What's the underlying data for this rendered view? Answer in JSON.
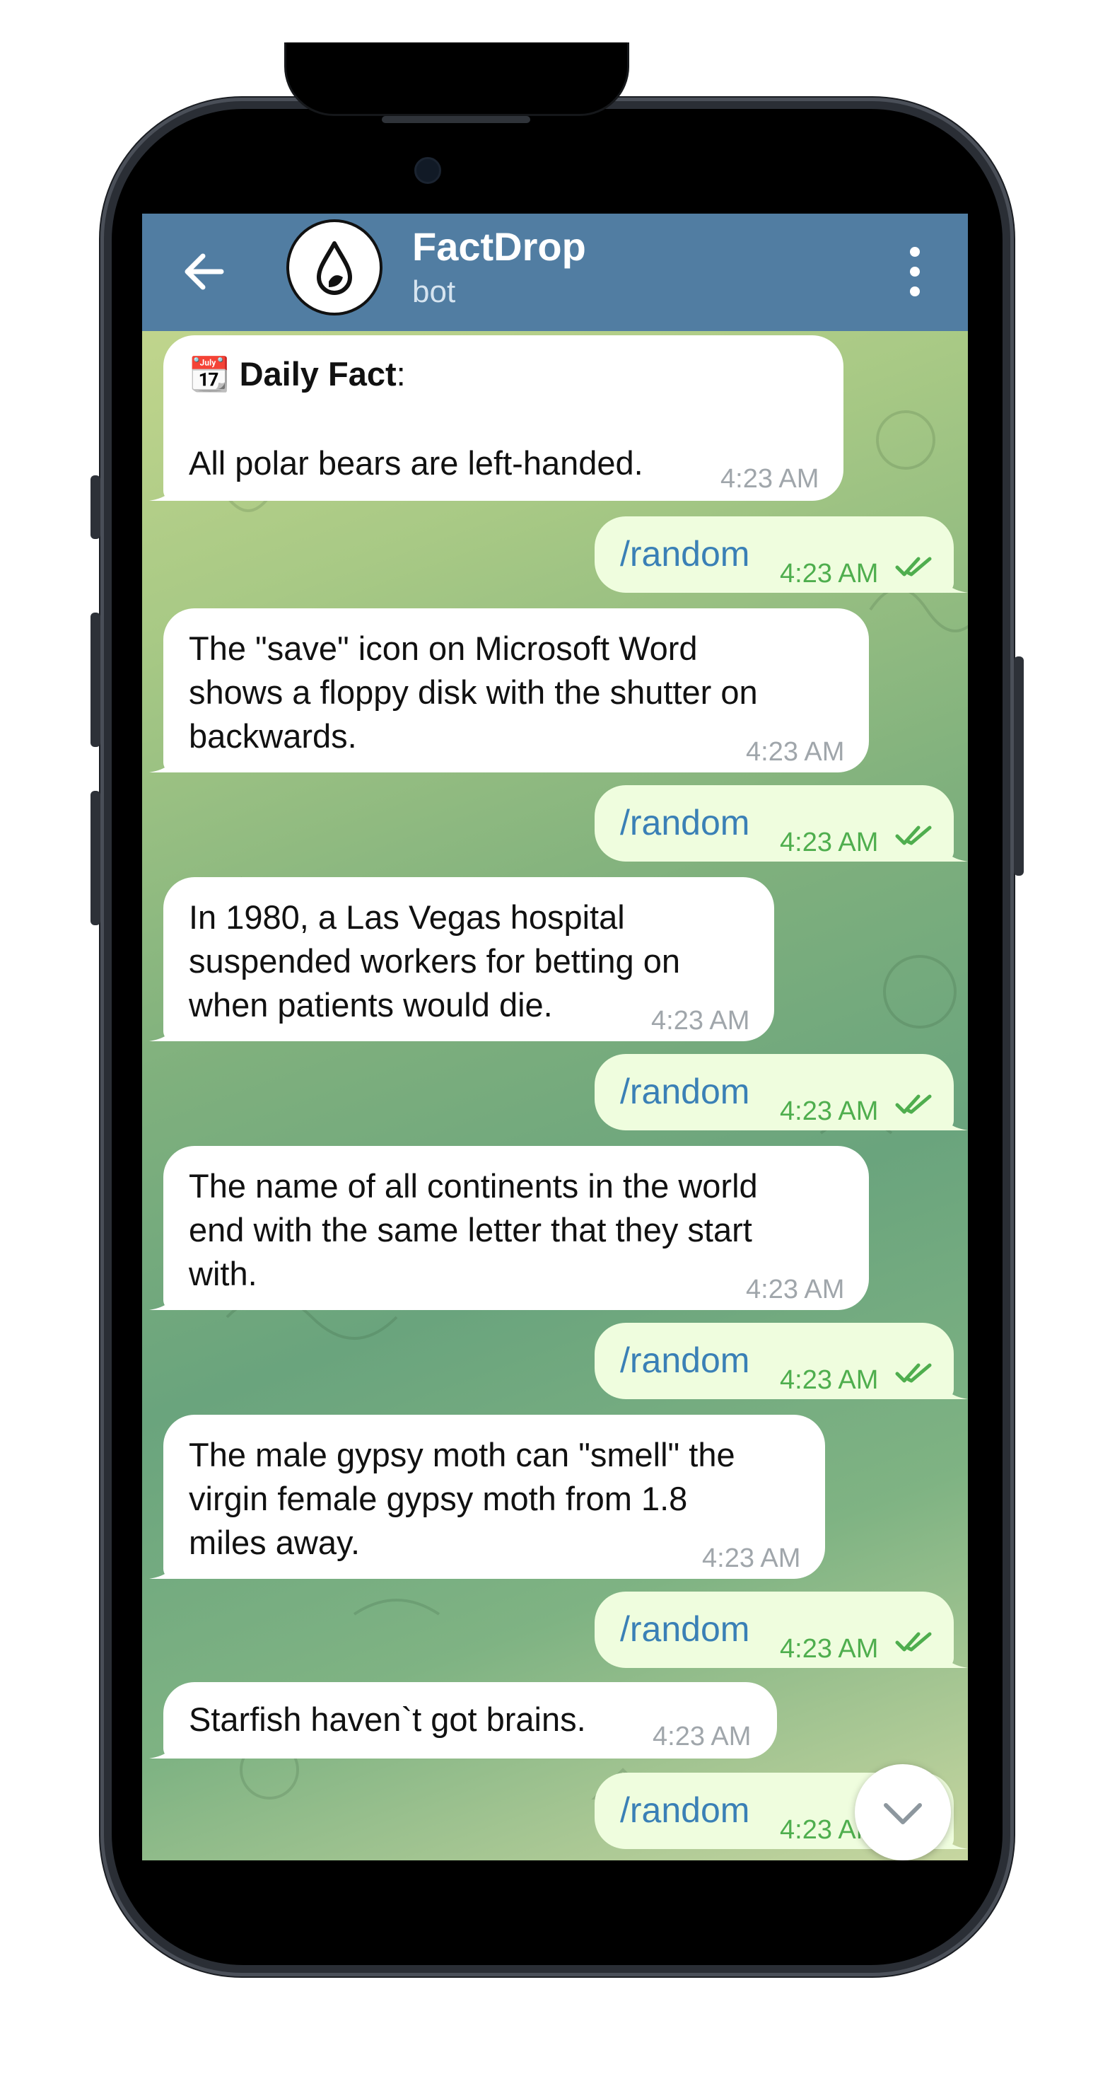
{
  "header": {
    "title": "FactDrop",
    "subtitle": "bot"
  },
  "messages": [
    {
      "type": "incoming",
      "lines": [
        "📆 Daily Fact:",
        "",
        "All polar bears are left-handed."
      ],
      "bold_prefix": "Daily Fact",
      "time": "4:23 AM"
    },
    {
      "type": "outgoing",
      "text": "/random",
      "time": "4:23 AM",
      "status": "read"
    },
    {
      "type": "incoming",
      "text": "The \"save\" icon on Microsoft Word\nshows a floppy disk with the shutter on\nbackwards.",
      "time": "4:23 AM"
    },
    {
      "type": "outgoing",
      "text": "/random",
      "time": "4:23 AM",
      "status": "read"
    },
    {
      "type": "incoming",
      "text": "In 1980, a Las Vegas hospital\nsuspended workers for betting on\nwhen patients would die.",
      "time": "4:23 AM"
    },
    {
      "type": "outgoing",
      "text": "/random",
      "time": "4:23 AM",
      "status": "read"
    },
    {
      "type": "incoming",
      "text": "The name of all continents in the world\nend with the same letter that they start\nwith.",
      "time": "4:23 AM"
    },
    {
      "type": "outgoing",
      "text": "/random",
      "time": "4:23 AM",
      "status": "read"
    },
    {
      "type": "incoming",
      "text": "The male gypsy moth can \"smell\" the\nvirgin female gypsy moth from 1.8\nmiles away.",
      "time": "4:23 AM"
    },
    {
      "type": "outgoing",
      "text": "/random",
      "time": "4:23 AM",
      "status": "read"
    },
    {
      "type": "incoming",
      "text": "Starfish haven`t got brains.",
      "time": "4:23 AM"
    },
    {
      "type": "outgoing",
      "text": "/random",
      "time": "4:23 AM",
      "status": "read"
    }
  ],
  "daily_fact": {
    "emoji": "📆",
    "label": "Daily Fact",
    "colon": ":",
    "body": "All polar bears are left-handed."
  },
  "colors": {
    "header": "#517da2",
    "bubble_in": "#ffffff",
    "bubble_out": "#effdde",
    "command_link": "#3a80b6",
    "out_time": "#4fae4e",
    "in_time": "#a0a6ab"
  },
  "icons": {
    "back": "arrow-left-icon",
    "avatar": "drop-logo-icon",
    "menu": "more-vertical-icon",
    "read": "double-check-icon",
    "scroll": "chevron-down-icon"
  }
}
